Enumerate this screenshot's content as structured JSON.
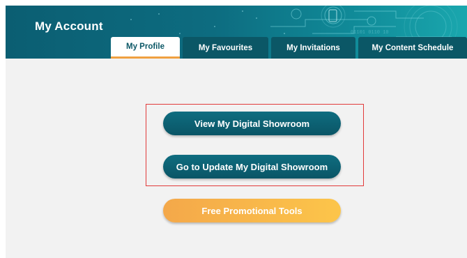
{
  "header": {
    "title": "My Account",
    "tabs": [
      {
        "label": "My Profile",
        "active": true
      },
      {
        "label": "My Favourites",
        "active": false
      },
      {
        "label": "My Invitations",
        "active": false
      },
      {
        "label": "My Content Schedule",
        "active": false
      }
    ]
  },
  "main": {
    "view_showroom_label": "View My Digital Showroom",
    "update_showroom_label": "Go to Update My Digital Showroom",
    "promo_tools_label": "Free Promotional Tools"
  },
  "colors": {
    "header_teal": "#0b5e72",
    "button_teal": "#0a5566",
    "accent_orange": "#f4a84a",
    "highlight_red": "#e23a3a"
  }
}
